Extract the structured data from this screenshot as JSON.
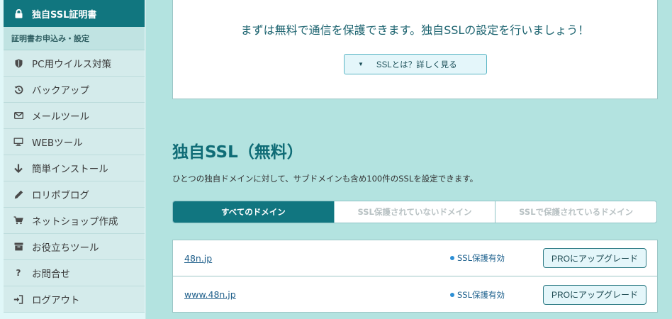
{
  "sidebar": {
    "active": {
      "label": "独自SSL証明書",
      "icon": "lock-icon"
    },
    "sub": {
      "label": "証明書お申込み・設定"
    },
    "items": [
      {
        "label": "PC用ウイルス対策",
        "icon": "shield-icon"
      },
      {
        "label": "バックアップ",
        "icon": "history-icon"
      },
      {
        "label": "メールツール",
        "icon": "envelope-icon"
      },
      {
        "label": "WEBツール",
        "icon": "monitor-icon"
      },
      {
        "label": "簡単インストール",
        "icon": "download-arrow-icon"
      },
      {
        "label": "ロリポブログ",
        "icon": "pencil-icon"
      },
      {
        "label": "ネットショップ作成",
        "icon": "cart-icon"
      },
      {
        "label": "お役立ちツール",
        "icon": "archive-box-icon"
      },
      {
        "label": "お問合せ",
        "icon": "question-icon"
      },
      {
        "label": "ログアウト",
        "icon": "logout-icon"
      }
    ]
  },
  "main": {
    "top_message": "まずは無料で通信を保護できます。独自SSLの設定を行いましょう！",
    "ssl_info_button": "SSLとは？詳しく見る",
    "section_title": "独自SSL（無料）",
    "section_description": "ひとつの独自ドメインに対して、サブドメインも含め100件のSSLを設定できます。",
    "tabs": [
      {
        "label": "すべてのドメイン",
        "active": true
      },
      {
        "label": "SSL保護されていないドメイン",
        "active": false
      },
      {
        "label": "SSLで保護されているドメイン",
        "active": false
      }
    ],
    "domains": [
      {
        "name": "48n.jp",
        "status": "SSL保護有効",
        "action": "PROにアップグレード"
      },
      {
        "name": "www.48n.jp",
        "status": "SSL保護有効",
        "action": "PROにアップグレード"
      }
    ]
  },
  "colors": {
    "accent": "#11767f",
    "background": "#b3e3e0",
    "status_dot": "#2d8fd5"
  }
}
